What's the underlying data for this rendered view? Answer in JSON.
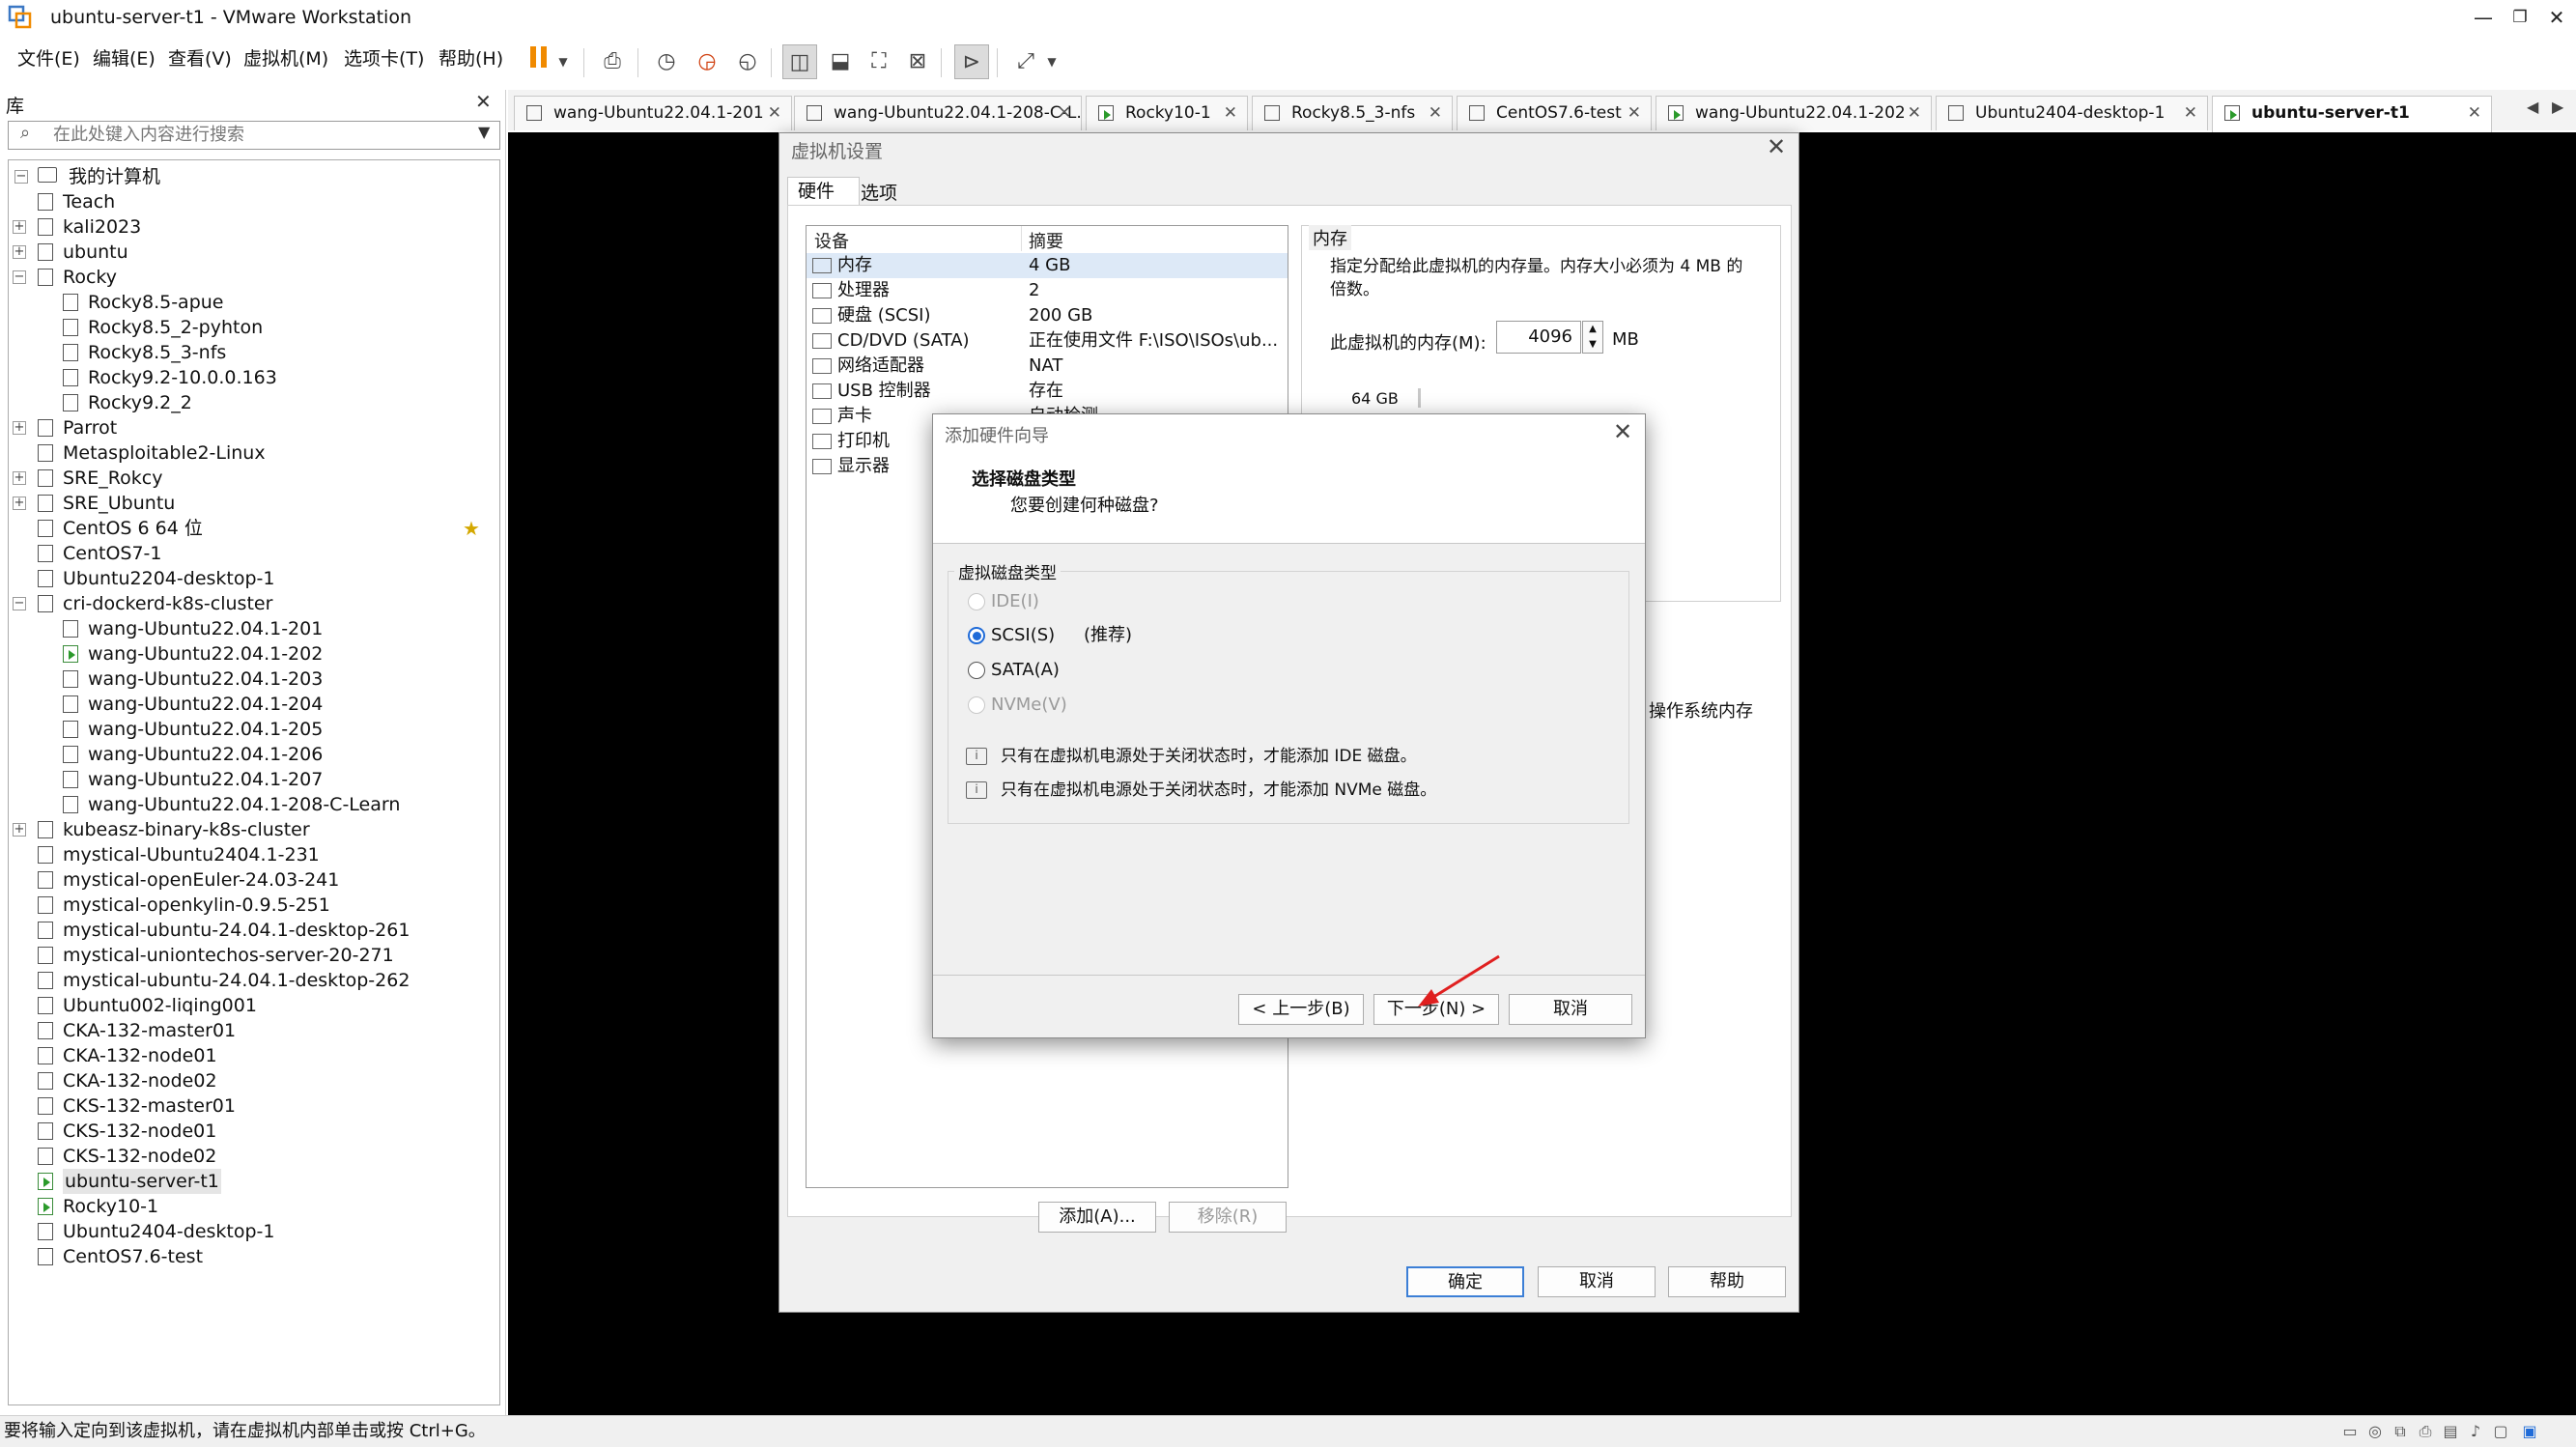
{
  "window": {
    "title": "ubuntu-server-t1 - VMware Workstation",
    "minimize": "—",
    "restore": "❐",
    "close": "✕"
  },
  "menu": [
    "文件(E)",
    "编辑(E)",
    "查看(V)",
    "虚拟机(M)",
    "选项卡(T)",
    "帮助(H)"
  ],
  "library": {
    "title": "库",
    "close": "✕",
    "search_placeholder": "在此处键入内容进行搜索",
    "root": "我的计算机",
    "items": [
      {
        "label": "Teach",
        "level": 1
      },
      {
        "label": "kali2023",
        "level": 1,
        "expander": "+"
      },
      {
        "label": "ubuntu",
        "level": 1,
        "expander": "+"
      },
      {
        "label": "Rocky",
        "level": 1,
        "expander": "−"
      },
      {
        "label": "Rocky8.5-apue",
        "level": 2
      },
      {
        "label": "Rocky8.5_2-pyhton",
        "level": 2
      },
      {
        "label": "Rocky8.5_3-nfs",
        "level": 2
      },
      {
        "label": "Rocky9.2-10.0.0.163",
        "level": 2
      },
      {
        "label": "Rocky9.2_2",
        "level": 2
      },
      {
        "label": "Parrot",
        "level": 1,
        "expander": "+"
      },
      {
        "label": "Metasploitable2-Linux",
        "level": 1
      },
      {
        "label": "SRE_Rokcy",
        "level": 1,
        "expander": "+"
      },
      {
        "label": "SRE_Ubuntu",
        "level": 1,
        "expander": "+"
      },
      {
        "label": "CentOS 6 64 位",
        "level": 1,
        "star": true
      },
      {
        "label": "CentOS7-1",
        "level": 1
      },
      {
        "label": "Ubuntu2204-desktop-1",
        "level": 1
      },
      {
        "label": "cri-dockerd-k8s-cluster",
        "level": 1,
        "expander": "−"
      },
      {
        "label": "wang-Ubuntu22.04.1-201",
        "level": 2
      },
      {
        "label": "wang-Ubuntu22.04.1-202",
        "level": 2,
        "running": true
      },
      {
        "label": "wang-Ubuntu22.04.1-203",
        "level": 2
      },
      {
        "label": "wang-Ubuntu22.04.1-204",
        "level": 2
      },
      {
        "label": "wang-Ubuntu22.04.1-205",
        "level": 2
      },
      {
        "label": "wang-Ubuntu22.04.1-206",
        "level": 2
      },
      {
        "label": "wang-Ubuntu22.04.1-207",
        "level": 2
      },
      {
        "label": "wang-Ubuntu22.04.1-208-C-Learn",
        "level": 2
      },
      {
        "label": "kubeasz-binary-k8s-cluster",
        "level": 1,
        "expander": "+"
      },
      {
        "label": "mystical-Ubuntu2404.1-231",
        "level": 1
      },
      {
        "label": "mystical-openEuler-24.03-241",
        "level": 1
      },
      {
        "label": "mystical-openkylin-0.9.5-251",
        "level": 1
      },
      {
        "label": "mystical-ubuntu-24.04.1-desktop-261",
        "level": 1
      },
      {
        "label": "mystical-uniontechos-server-20-271",
        "level": 1
      },
      {
        "label": "mystical-ubuntu-24.04.1-desktop-262",
        "level": 1
      },
      {
        "label": "Ubuntu002-liqing001",
        "level": 1
      },
      {
        "label": "CKA-132-master01",
        "level": 1
      },
      {
        "label": "CKA-132-node01",
        "level": 1
      },
      {
        "label": "CKA-132-node02",
        "level": 1
      },
      {
        "label": "CKS-132-master01",
        "level": 1
      },
      {
        "label": "CKS-132-node01",
        "level": 1
      },
      {
        "label": "CKS-132-node02",
        "level": 1
      },
      {
        "label": "ubuntu-server-t1",
        "level": 1,
        "running": true,
        "selected": true
      },
      {
        "label": "Rocky10-1",
        "level": 1,
        "running": true
      },
      {
        "label": "Ubuntu2404-desktop-1",
        "level": 1
      },
      {
        "label": "CentOS7.6-test",
        "level": 1
      }
    ]
  },
  "tabs": [
    {
      "label": "wang-Ubuntu22.04.1-201"
    },
    {
      "label": "wang-Ubuntu22.04.1-208-C-L..."
    },
    {
      "label": "Rocky10-1",
      "running": true
    },
    {
      "label": "Rocky8.5_3-nfs"
    },
    {
      "label": "CentOS7.6-test"
    },
    {
      "label": "wang-Ubuntu22.04.1-202",
      "running": true
    },
    {
      "label": "Ubuntu2404-desktop-1"
    },
    {
      "label": "ubuntu-server-t1",
      "running": true,
      "active": true
    }
  ],
  "tab_close": "✕",
  "settings": {
    "title": "虚拟机设置",
    "tabs": [
      "硬件",
      "选项"
    ],
    "col_device": "设备",
    "col_summary": "摘要",
    "devices": [
      {
        "name": "内存",
        "value": "4 GB"
      },
      {
        "name": "处理器",
        "value": "2"
      },
      {
        "name": "硬盘 (SCSI)",
        "value": "200 GB"
      },
      {
        "name": "CD/DVD (SATA)",
        "value": "正在使用文件 F:\\ISO\\ISOs\\ub..."
      },
      {
        "name": "网络适配器",
        "value": "NAT"
      },
      {
        "name": "USB 控制器",
        "value": "存在"
      },
      {
        "name": "声卡",
        "value": "自动检测"
      },
      {
        "name": "打印机",
        "value": ""
      },
      {
        "name": "显示器",
        "value": ""
      }
    ],
    "memory_title": "内存",
    "memory_desc": "指定分配给此虚拟机的内存量。内存大小必须为 4 MB 的倍数。",
    "memory_label": "此虚拟机的内存(M):",
    "memory_value": "4096",
    "memory_unit": "MB",
    "memory_scale_top": "64 GB",
    "memory_side_text": "操作系统内存",
    "add_button": "添加(A)...",
    "remove_button": "移除(R)",
    "ok_button": "确定",
    "cancel_button": "取消",
    "help_button": "帮助"
  },
  "wizard": {
    "title": "添加硬件向导",
    "heading": "选择磁盘类型",
    "subheading": "您要创建何种磁盘?",
    "group_label": "虚拟磁盘类型",
    "options": [
      {
        "label": "IDE(I)",
        "disabled": true
      },
      {
        "label": "SCSI(S)",
        "selected": true,
        "hint": "(推荐)"
      },
      {
        "label": "SATA(A)"
      },
      {
        "label": "NVMe(V)",
        "disabled": true
      }
    ],
    "notes": [
      "只有在虚拟机电源处于关闭状态时，才能添加 IDE 磁盘。",
      "只有在虚拟机电源处于关闭状态时，才能添加 NVMe 磁盘。"
    ],
    "back_button": "< 上一步(B)",
    "next_button": "下一步(N) >",
    "cancel_button": "取消"
  },
  "status_text": "要将输入定向到该虚拟机，请在虚拟机内部单击或按 Ctrl+G。",
  "colors": {
    "accent": "#1f6bd8",
    "pause": "#f08a00",
    "annotation_arrow": "#e02020",
    "selection": "#dde9f7"
  }
}
